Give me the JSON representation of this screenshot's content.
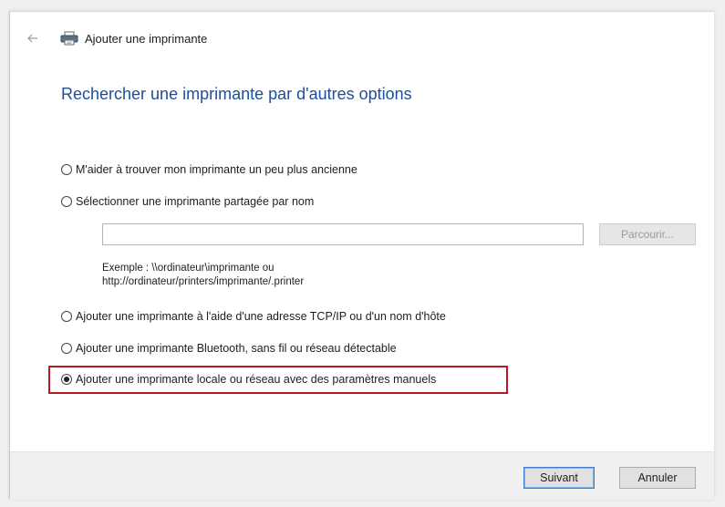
{
  "window": {
    "title": "Ajouter une imprimante"
  },
  "icons": {
    "back": "back-arrow-icon",
    "printer": "printer-icon"
  },
  "page": {
    "heading": "Rechercher une imprimante par d'autres options"
  },
  "options": [
    {
      "label": "M'aider à trouver mon imprimante un peu plus ancienne",
      "checked": false
    },
    {
      "label": "Sélectionner une imprimante partagée par nom",
      "checked": false
    },
    {
      "label": "Ajouter une imprimante à l'aide d'une adresse TCP/IP ou d'un nom d'hôte",
      "checked": false
    },
    {
      "label": "Ajouter une imprimante Bluetooth, sans fil ou réseau détectable",
      "checked": false
    },
    {
      "label": "Ajouter une imprimante locale ou réseau avec des paramètres manuels",
      "checked": true
    }
  ],
  "shared_name": {
    "value": "",
    "browse_label": "Parcourir...",
    "example_line1": "Exemple : \\\\ordinateur\\imprimante ou",
    "example_line2": "http://ordinateur/printers/imprimante/.printer"
  },
  "footer": {
    "next_label": "Suivant",
    "cancel_label": "Annuler"
  },
  "colors": {
    "heading": "#1c4e9c",
    "highlight": "#b8191e",
    "primary_button_border": "#3c7fd6"
  }
}
